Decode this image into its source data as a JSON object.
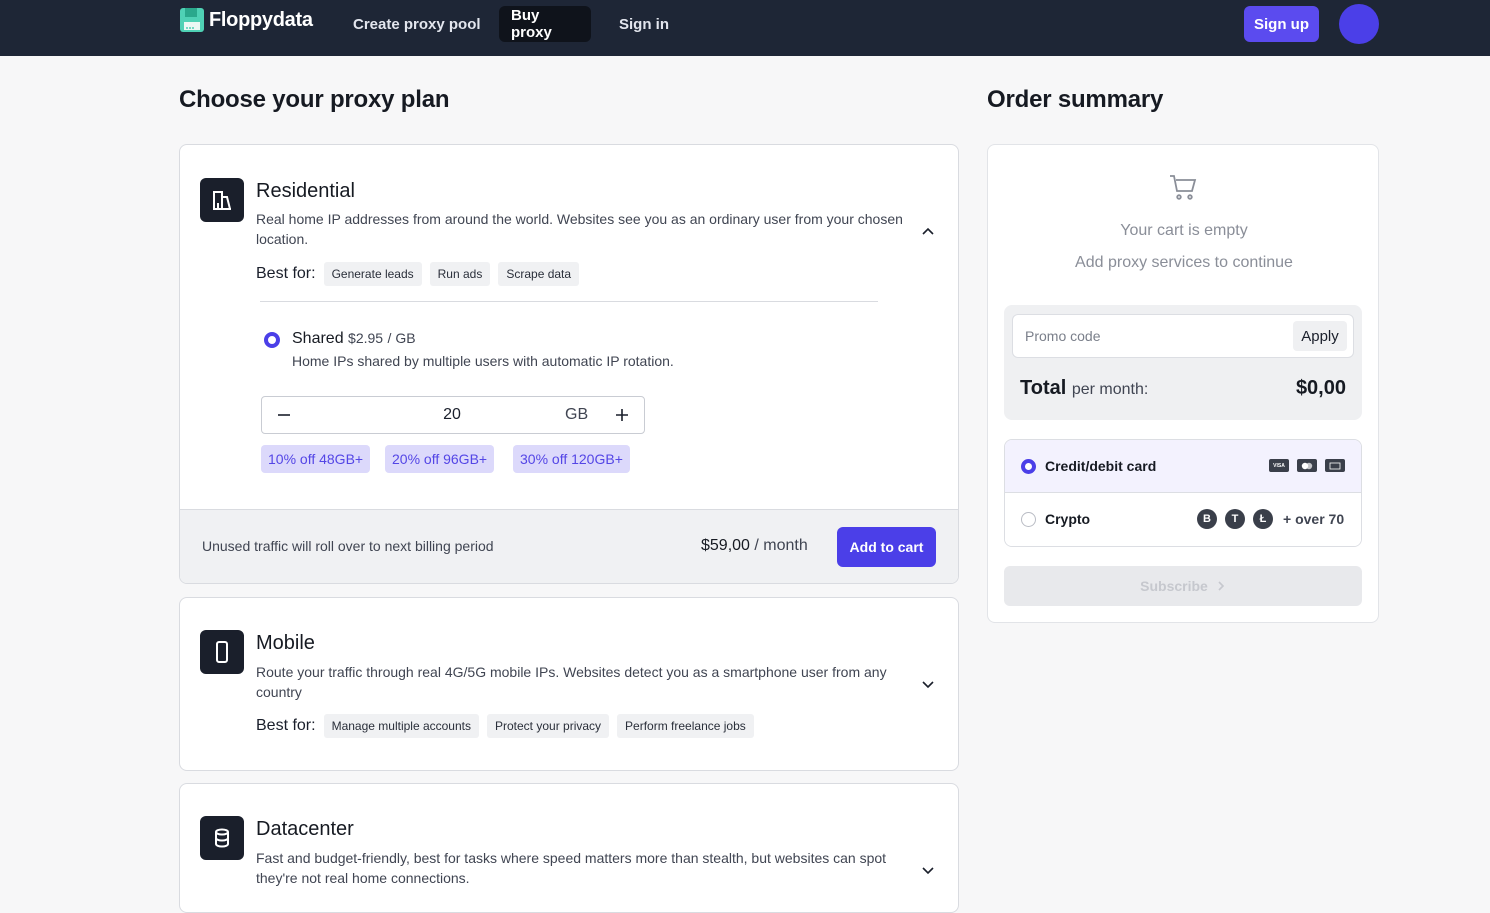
{
  "nav": {
    "brand": "Floppydata",
    "links": [
      "Create proxy pool",
      "Buy proxy",
      "Sign in"
    ],
    "active": "Buy proxy",
    "signup_label": "Sign up"
  },
  "main": {
    "title": "Choose your proxy plan",
    "plans": [
      {
        "name": "Residential",
        "icon": "building-icon",
        "description": "Real home IP addresses from around the world. Websites see you as an ordinary user from your chosen location.",
        "best_for_label": "Best for:",
        "tags": [
          "Generate leads",
          "Run ads",
          "Scrape data"
        ],
        "expanded": true,
        "option": {
          "name": "Shared",
          "price": "$2.95",
          "unit": "/ GB",
          "description": "Home IPs shared by multiple users with automatic IP rotation.",
          "quantity": "20",
          "quantity_unit": "GB"
        },
        "discounts": [
          "10% off 48GB+",
          "20% off 96GB+",
          "30% off 120GB+"
        ],
        "footer_note": "Unused traffic will roll over to next billing period",
        "total_price": "$59,00",
        "total_period": "/ month",
        "add_label": "Add to cart"
      },
      {
        "name": "Mobile",
        "icon": "smartphone-icon",
        "description": "Route your traffic through real 4G/5G mobile IPs. Websites detect you as a smartphone user from any country",
        "best_for_label": "Best for:",
        "tags": [
          "Manage multiple accounts",
          "Protect your privacy",
          "Perform freelance jobs"
        ],
        "expanded": false
      },
      {
        "name": "Datacenter",
        "icon": "database-icon",
        "description": "Fast and budget-friendly, best for tasks where speed matters more than stealth, but websites can spot they're not real home connections.",
        "expanded": false
      }
    ]
  },
  "summary": {
    "title": "Order summary",
    "empty_title": "Your cart is empty",
    "empty_subtitle": "Add proxy services to continue",
    "promo_placeholder": "Promo code",
    "apply_label": "Apply",
    "total_label": "Total",
    "total_suffix": "per month:",
    "total_value": "$0,00",
    "payment_methods": [
      {
        "label": "Credit/debit card",
        "selected": true,
        "logos": [
          "VISA",
          "mastercard",
          "card"
        ]
      },
      {
        "label": "Crypto",
        "selected": false,
        "coins": [
          "B",
          "T",
          "Ł"
        ],
        "extra": "+ over 70"
      }
    ],
    "subscribe_label": "Subscribe"
  },
  "colors": {
    "accent": "#4b3fe8",
    "nav_bg": "#1e2636",
    "discount_bg": "#dcd9fb"
  }
}
